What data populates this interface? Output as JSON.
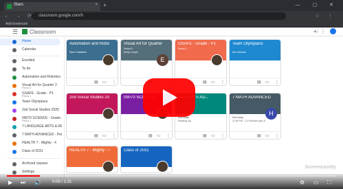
{
  "browser": {
    "tab_title": "Stars",
    "tab_close": "×",
    "new_tab": "+",
    "window_controls": "— ▢ ✕",
    "nav_icons": "← → ⟳",
    "url": "classroom.google.com/h",
    "bookmark": "Add bookmark",
    "extensions": "☆ ⋮"
  },
  "app": {
    "name": "Classroom",
    "menu_icon": "☰",
    "plus_icon": "+",
    "apps_icon": "⋮⋮"
  },
  "sidebar": {
    "top_items": [
      {
        "label": "Home",
        "icon_color": "#1967d2"
      },
      {
        "label": "Calendar",
        "icon_color": "#5f6368"
      }
    ],
    "section_label": "Enrolled",
    "section_items": [
      {
        "label": "To do",
        "icon_color": "#5f6368",
        "sub": ""
      },
      {
        "label": "Automation and Robotics - Hu...",
        "icon_color": "#1e8e3e",
        "sub": ""
      },
      {
        "label": "Visual Art for Quarter 2",
        "icon_color": "#e8710a",
        "sub": "Period 5"
      },
      {
        "label": "GSAFE - Grade - P1",
        "icon_color": "#d93025",
        "sub": "Period 1"
      },
      {
        "label": "Team Olympians",
        "icon_color": "#1a73e8",
        "sub": ""
      },
      {
        "label": "2nd Social Studies 2025",
        "icon_color": "#a142f4",
        "sub": ""
      },
      {
        "label": "09070 SCIENCE - Grade...",
        "icon_color": "#c5221f",
        "sub": "Period 2"
      },
      {
        "label": "7 LANGUAGE ARTS & READ...",
        "icon_color": "#129eaf",
        "sub": ""
      },
      {
        "label": "7 MATH ADVANCED - Per...",
        "icon_color": "#5f6368",
        "sub": ""
      },
      {
        "label": "HEALTH 7 - Mighty - 4",
        "icon_color": "#e8710a",
        "sub": ""
      },
      {
        "label": "Class of 2031",
        "icon_color": "#1a73e8",
        "sub": ""
      }
    ],
    "bottom_items": [
      {
        "label": "Archived classes",
        "icon_color": "#5f6368"
      },
      {
        "label": "Settings",
        "icon_color": "#5f6368"
      }
    ]
  },
  "cards": [
    {
      "title": "Automation and Roboti...",
      "section": "",
      "teacher": "Ryan Gustafson",
      "color": "#3c6e8f",
      "avatar": "photo",
      "letter": "",
      "body1": "",
      "body2": ""
    },
    {
      "title": "Visual Art for Quarter 2",
      "section": "Period 5",
      "teacher": "Emily Cooper",
      "color": "#546e7a",
      "avatar": "letter",
      "letter": "E",
      "avatar_color": "#5d4037",
      "body1": "",
      "body2": ""
    },
    {
      "title": "GSAFE - Grade - P1",
      "section": "Period 1",
      "teacher": "",
      "color": "#f06a4b",
      "avatar": "photo",
      "letter": "",
      "body1": "",
      "body2": ""
    },
    {
      "title": "Team Olympians",
      "section": "",
      "teacher": "Mrs Johnson",
      "color": "#1e88d0",
      "avatar": "none",
      "letter": "",
      "body1": "",
      "body2": ""
    },
    {
      "title": "2nd Social Studies 2025",
      "section": "",
      "teacher": "",
      "color": "#c2185b",
      "avatar": "photo",
      "letter": "",
      "body1": "",
      "body2": ""
    },
    {
      "title": "09070 SCIENCE",
      "section": "",
      "teacher": "",
      "color": "#7b1fa2",
      "avatar": "photo",
      "letter": "",
      "body1": "",
      "body2": ""
    },
    {
      "title": "AGE ARTS AD...",
      "section": "",
      "teacher": "",
      "color": "#00897b",
      "avatar": "none",
      "letter": "",
      "body1": "Due today",
      "body2": "Reading log"
    },
    {
      "title": "7 MATH ADVANCED ...",
      "section": "",
      "teacher": "",
      "color": "#455a64",
      "avatar": "letter",
      "letter": "H",
      "avatar_color": "#3949ab",
      "body1": "Due today",
      "body2": "11:59 PM - 2.4 Practice (day 2)"
    },
    {
      "title": "HEALTH 7 - Mighty - 4",
      "section": "",
      "teacher": "",
      "color": "#ef6c3a",
      "avatar": "photo",
      "letter": "",
      "body1": "",
      "body2": ""
    },
    {
      "title": "Class of 2031",
      "section": "",
      "teacher": "",
      "color": "#1565c0",
      "avatar": "photo",
      "letter": "",
      "body1": "",
      "body2": ""
    }
  ],
  "card_footer_icons": [
    "▤",
    "▭",
    "⋮"
  ],
  "video": {
    "play_icon": "play",
    "time": "0:09 / 1:31",
    "progress": 0.1,
    "controls_left": [
      "▶",
      "⏭",
      "🔊"
    ],
    "controls_right": [
      "⚙",
      "▭",
      "⛶"
    ],
    "watermark": "Screencastify"
  }
}
